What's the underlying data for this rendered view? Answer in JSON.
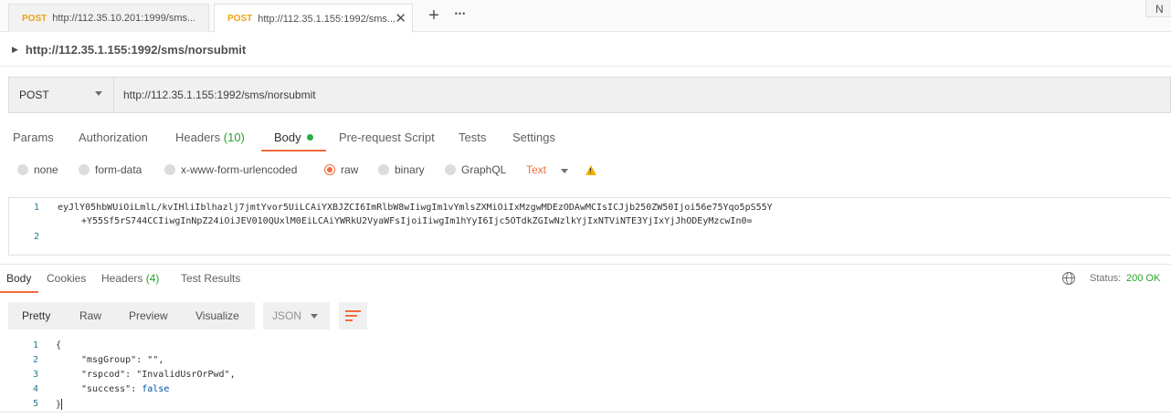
{
  "tabs": [
    {
      "method": "POST",
      "url": "http://112.35.10.201:1999/sms..."
    },
    {
      "method": "POST",
      "url": "http://112.35.1.155:1992/sms..."
    }
  ],
  "tab_actions": {
    "add": "+",
    "more": "•••",
    "close": "✕"
  },
  "corner_label": "N",
  "request": {
    "title": "http://112.35.1.155:1992/sms/norsubmit",
    "method": "POST",
    "url": "http://112.35.1.155:1992/sms/norsubmit"
  },
  "request_tabs": [
    {
      "label": "Params"
    },
    {
      "label": "Authorization"
    },
    {
      "label": "Headers",
      "count": "(10)"
    },
    {
      "label": "Body"
    },
    {
      "label": "Pre-request Script"
    },
    {
      "label": "Tests"
    },
    {
      "label": "Settings"
    }
  ],
  "body_types": [
    "none",
    "form-data",
    "x-www-form-urlencoded",
    "raw",
    "binary",
    "GraphQL"
  ],
  "body_type_selected": "raw",
  "raw_format": "Text",
  "editor": {
    "line_numbers": [
      "1",
      "2"
    ],
    "line1": "eyJlY05hbWUiOiLmlL/kvIHliIblhazlj7jmtYvor5UiLCAiYXBJZCI6ImRlbW8wIiwgIm1vYmlsZXMiOiIxMzgwMDEzODAwMCIsICJjb250ZW50Ijoi56e75Yqo5pS55Y",
    "line1_wrap": "+Y55Sf5rS744CCIiwgInNpZ24iOiJEV010QUxlM0EiLCAiYWRkU2VyaWFsIjoiIiwgIm1hYyI6Ijc5OTdkZGIwNzlkYjIxNTViNTE3YjIxYjJhODEyMzcwIn0=",
    "line2": ""
  },
  "response_tabs": [
    {
      "label": "Body"
    },
    {
      "label": "Cookies"
    },
    {
      "label": "Headers",
      "count": "(4)"
    },
    {
      "label": "Test Results"
    }
  ],
  "status": {
    "label": "Status:",
    "value": "200 OK"
  },
  "response_formats": [
    "Pretty",
    "Raw",
    "Preview",
    "Visualize"
  ],
  "response_language": "JSON",
  "response": {
    "line_numbers": [
      "1",
      "2",
      "3",
      "4",
      "5"
    ],
    "open_brace": "{",
    "close_brace": "}",
    "k1": "\"msgGroup\"",
    "v1": "\"\"",
    "k2": "\"rspcod\"",
    "v2": "\"InvalidUsrOrPwd\"",
    "k3": "\"success\"",
    "v3": "false"
  },
  "colors": {
    "accent": "#f26b3a",
    "method": "#e8a317",
    "success": "#29a329"
  }
}
